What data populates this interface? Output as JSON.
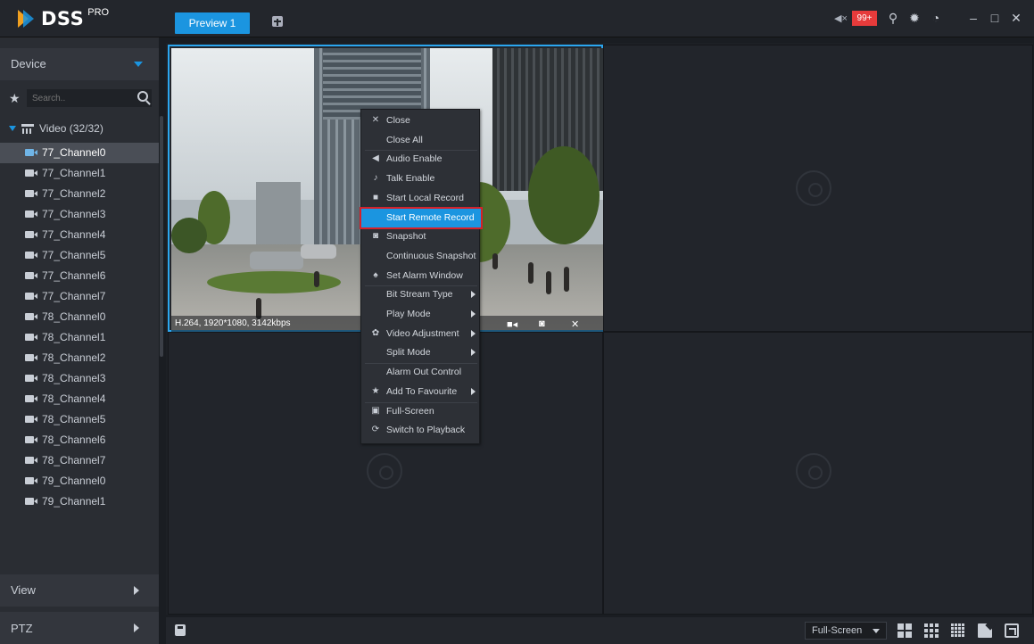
{
  "app": {
    "title": "DSS",
    "title_sup": "PRO"
  },
  "tabs": [
    {
      "label": "Preview 1"
    }
  ],
  "topbar": {
    "alarm_count": "99+"
  },
  "sidebar": {
    "device_label": "Device",
    "search_placeholder": "Search..",
    "root_label": "Video (32/32)",
    "channels": [
      "77_Channel0",
      "77_Channel1",
      "77_Channel2",
      "77_Channel3",
      "77_Channel4",
      "77_Channel5",
      "77_Channel6",
      "77_Channel7",
      "78_Channel0",
      "78_Channel1",
      "78_Channel2",
      "78_Channel3",
      "78_Channel4",
      "78_Channel5",
      "78_Channel6",
      "78_Channel7",
      "79_Channel0",
      "79_Channel1"
    ],
    "selected_channel": "77_Channel0",
    "view_label": "View",
    "ptz_label": "PTZ"
  },
  "video": {
    "info": "H.264, 1920*1080, 3142kbps"
  },
  "context_menu": {
    "items": [
      {
        "label": "Close",
        "icon": "close-icon"
      },
      {
        "label": "Close All",
        "icon": ""
      },
      {
        "label": "Audio Enable",
        "icon": "mute-icon"
      },
      {
        "label": "Talk Enable",
        "icon": "microphone-icon"
      },
      {
        "label": "Start Local Record",
        "icon": "video-camera-icon"
      },
      {
        "label": "Start Remote Record",
        "icon": "",
        "highlighted": true
      },
      {
        "label": "Snapshot",
        "icon": "camera-icon"
      },
      {
        "label": "Continuous Snapshot",
        "icon": ""
      },
      {
        "label": "Set Alarm Window",
        "icon": "bell-icon"
      },
      {
        "label": "Bit Stream Type",
        "icon": "",
        "submenu": true
      },
      {
        "label": "Play Mode",
        "icon": "",
        "submenu": true
      },
      {
        "label": "Video Adjustment",
        "icon": "adjust-icon",
        "submenu": true
      },
      {
        "label": "Split Mode",
        "icon": "",
        "submenu": true
      },
      {
        "label": "Alarm Out Control",
        "icon": ""
      },
      {
        "label": "Add To Favourite",
        "icon": "star-icon",
        "submenu": true
      },
      {
        "label": "Full-Screen",
        "icon": "fullscreen-icon"
      },
      {
        "label": "Switch to Playback",
        "icon": "playback-icon"
      }
    ]
  },
  "bottombar": {
    "fullscreen_select": "Full-Screen"
  },
  "colors": {
    "accent": "#1b95e0",
    "highlight_border": "#d6212a",
    "badge": "#e63b3b"
  }
}
